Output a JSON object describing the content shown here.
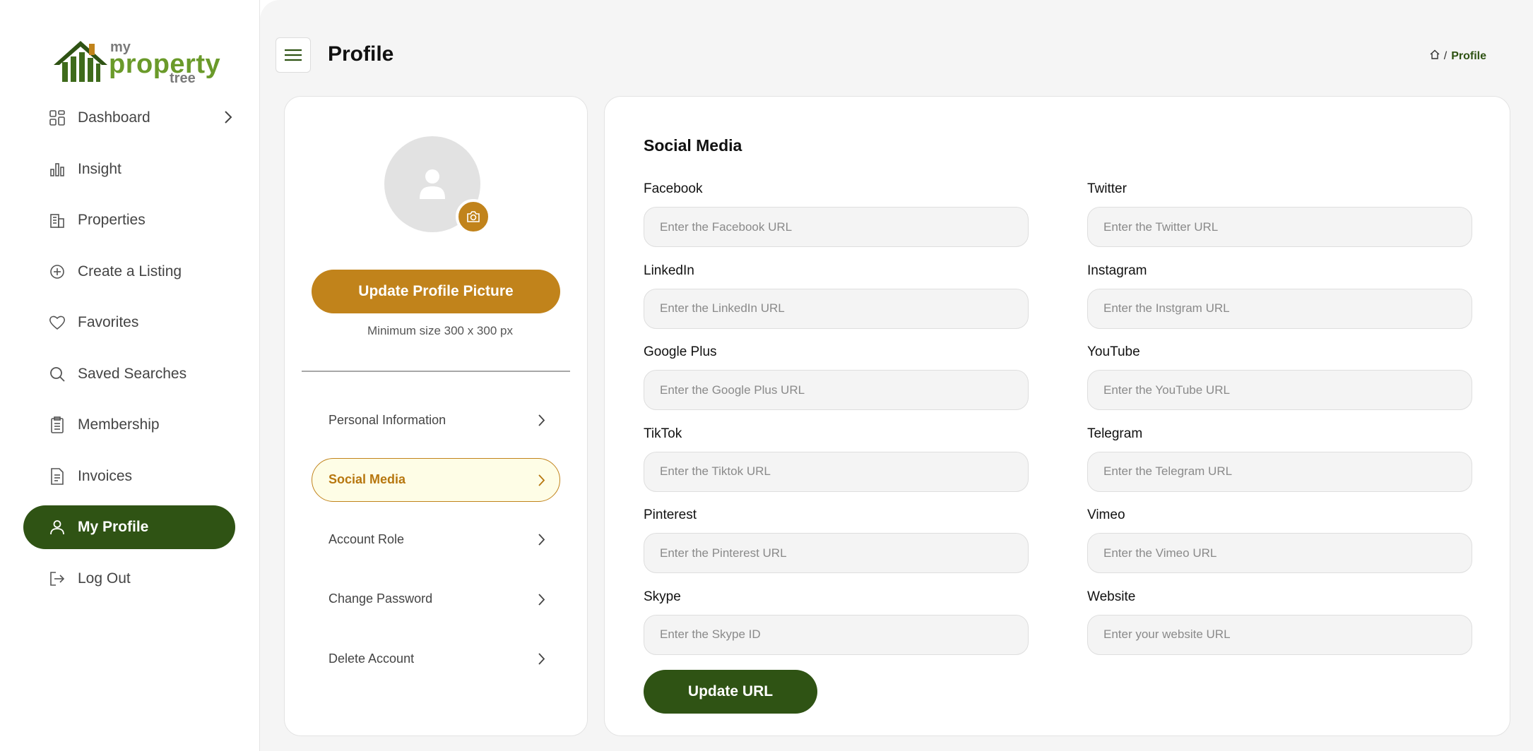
{
  "brand": {
    "my": "my",
    "property": "property",
    "tree": "tree",
    "colors": {
      "primary_green": "#2f5314",
      "logo_green": "#6a9a2a",
      "accent_gold": "#c1831b",
      "roof_orange": "#c1831b"
    }
  },
  "sidebar": {
    "items": [
      {
        "label": "Dashboard",
        "icon": "grid-icon",
        "has_chevron": true
      },
      {
        "label": "Insight",
        "icon": "bar-chart-icon"
      },
      {
        "label": "Properties",
        "icon": "building-icon"
      },
      {
        "label": "Create a Listing",
        "icon": "plus-circle-icon"
      },
      {
        "label": "Favorites",
        "icon": "heart-icon"
      },
      {
        "label": "Saved Searches",
        "icon": "search-icon"
      },
      {
        "label": "Membership",
        "icon": "clipboard-icon"
      },
      {
        "label": "Invoices",
        "icon": "invoice-icon"
      },
      {
        "label": "My Profile",
        "icon": "user-icon",
        "active": true
      },
      {
        "label": "Log Out",
        "icon": "logout-icon"
      }
    ]
  },
  "header": {
    "title": "Profile",
    "breadcrumb": {
      "separator": "/",
      "current": "Profile"
    }
  },
  "profile_card": {
    "update_picture_label": "Update Profile Picture",
    "min_size_text": "Minimum size 300 x 300 px",
    "menu": [
      {
        "label": "Personal Information"
      },
      {
        "label": "Social Media",
        "active": true
      },
      {
        "label": "Account Role"
      },
      {
        "label": "Change Password"
      },
      {
        "label": "Delete Account"
      }
    ]
  },
  "social": {
    "title": "Social Media",
    "fields": [
      {
        "label": "Facebook",
        "placeholder": "Enter the Facebook URL",
        "value": ""
      },
      {
        "label": "Twitter",
        "placeholder": "Enter the Twitter URL",
        "value": ""
      },
      {
        "label": "LinkedIn",
        "placeholder": "Enter the LinkedIn URL",
        "value": ""
      },
      {
        "label": "Instagram",
        "placeholder": "Enter the Instgram URL",
        "value": ""
      },
      {
        "label": "Google Plus",
        "placeholder": "Enter the Google Plus URL",
        "value": ""
      },
      {
        "label": "YouTube",
        "placeholder": "Enter the YouTube URL",
        "value": ""
      },
      {
        "label": "TikTok",
        "placeholder": "Enter the Tiktok URL",
        "value": ""
      },
      {
        "label": "Telegram",
        "placeholder": "Enter the Telegram URL",
        "value": ""
      },
      {
        "label": "Pinterest",
        "placeholder": "Enter the Pinterest URL",
        "value": ""
      },
      {
        "label": "Vimeo",
        "placeholder": "Enter the Vimeo URL",
        "value": ""
      },
      {
        "label": "Skype",
        "placeholder": "Enter the Skype ID",
        "value": ""
      },
      {
        "label": "Website",
        "placeholder": "Enter your website URL",
        "value": ""
      }
    ],
    "submit_label": "Update URL"
  }
}
